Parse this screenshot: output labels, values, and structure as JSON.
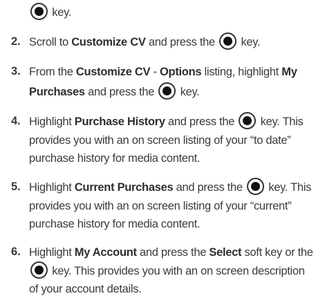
{
  "icons": {
    "ok_key": "ok-key-icon"
  },
  "step1_cont": {
    "b": "key."
  },
  "step2": {
    "num": "2.",
    "a": "Scroll to ",
    "b": "Customize CV",
    "c": " and press the ",
    "d": "key."
  },
  "step3": {
    "num": "3.",
    "l1": {
      "a": "From the ",
      "b": "Customize CV",
      "c": " - ",
      "d": "Options",
      "e": " listing, highlight ",
      "f": "My"
    },
    "l2": {
      "a": "Purchases",
      "b": " and press the ",
      "c": "key."
    }
  },
  "step4": {
    "num": "4.",
    "l1": {
      "a": "Highlight ",
      "b": "Purchase History",
      "c": " and press the ",
      "d": "key. This"
    },
    "l2": "provides you with an on screen listing of your “to date”",
    "l3": "purchase history for media content."
  },
  "step5": {
    "num": "5.",
    "l1": {
      "a": "Highlight ",
      "b": "Current Purchases",
      "c": " and press the ",
      "d": "key. This"
    },
    "l2": "provides you with an on screen listing of your “current”",
    "l3": "purchase history for media content."
  },
  "step6": {
    "num": "6.",
    "l1": {
      "a": "Highlight ",
      "b": "My Account",
      "c": " and press the ",
      "d": "Select",
      "e": " soft key or the"
    },
    "l2": {
      "b": "key. This provides you with an on screen description"
    },
    "l3": "of your account details."
  }
}
